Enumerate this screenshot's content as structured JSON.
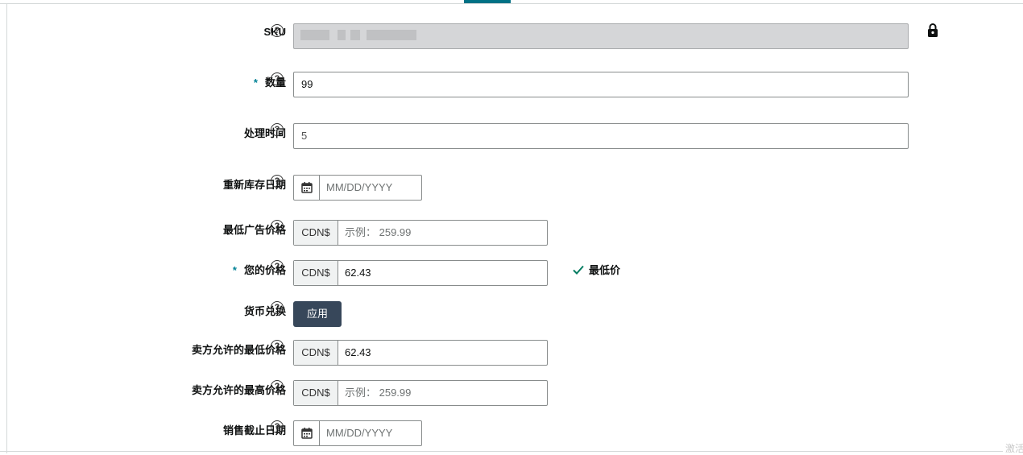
{
  "form": {
    "sku": {
      "label": "SKU",
      "value": ""
    },
    "quantity": {
      "required_mark": "*",
      "label": "数量",
      "value": "99"
    },
    "handling_time": {
      "label": "处理时间",
      "value": "5"
    },
    "restock_date": {
      "label": "重新库存日期",
      "placeholder": "MM/DD/YYYY"
    },
    "min_advertised_price": {
      "label": "最低广告价格",
      "currency": "CDN$",
      "placeholder": "示例： 259.99"
    },
    "your_price": {
      "required_mark": "*",
      "label": "您的价格",
      "currency": "CDN$",
      "value": "62.43",
      "status": "最低价"
    },
    "currency_conversion": {
      "label": "货币兑换",
      "button": "应用"
    },
    "seller_min_price": {
      "label": "卖方允许的最低价格",
      "currency": "CDN$",
      "value": "62.43"
    },
    "seller_max_price": {
      "label": "卖方允许的最高价格",
      "currency": "CDN$",
      "placeholder": "示例： 259.99"
    },
    "sale_end_date": {
      "label": "销售截止日期",
      "placeholder": "MM/DD/YYYY"
    }
  },
  "help_glyph": "?",
  "corner_text": "激活",
  "colors": {
    "accent": "#007185",
    "required": "#008296",
    "button": "#37475a",
    "check": "#067d62"
  },
  "icons": [
    "help-icon",
    "lock-icon",
    "calendar-icon",
    "checkmark-icon"
  ]
}
